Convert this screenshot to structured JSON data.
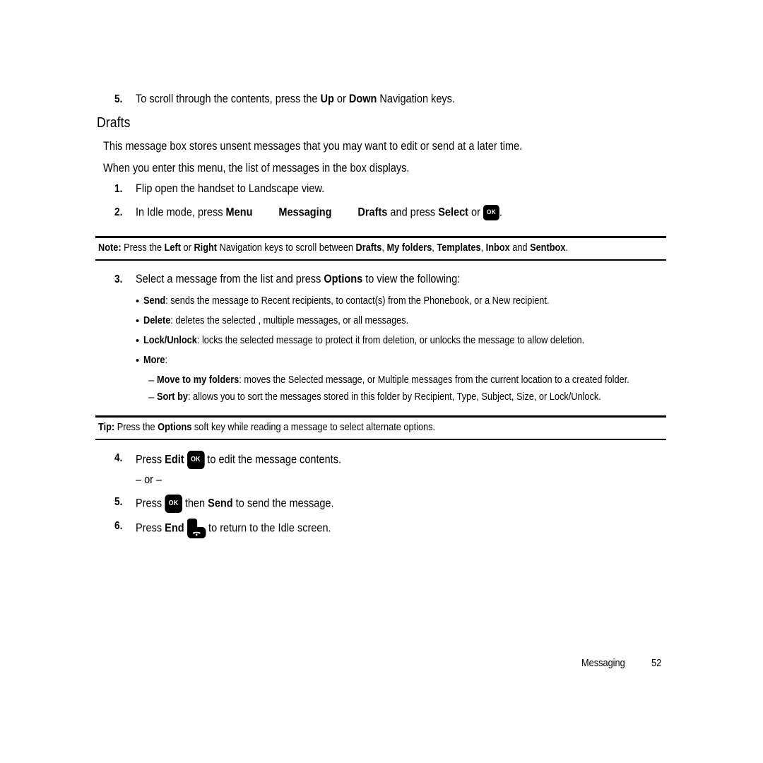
{
  "document": {
    "page_number": "52",
    "footer_section": "Messaging",
    "heading": "Drafts"
  },
  "intro_step": {
    "number": "5.",
    "text_before": "To scroll through the contents, press the ",
    "bold_1": "Up",
    "text_mid": " or ",
    "bold_2": "Down",
    "text_after": " Navigation keys."
  },
  "paragraphs": [
    "This message box stores unsent messages that you may want to edit or send at a later time.",
    "When you enter this menu, the list of messages in the box displays."
  ],
  "steps": {
    "one": {
      "number": "1.",
      "text": "Flip open the handset to Landscape view."
    },
    "two": {
      "number": "2.",
      "text_before": "In Idle mode, press ",
      "menu": "Menu",
      "messaging": "Messaging",
      "drafts": "Drafts",
      "text_mid": " and press ",
      "select": "Select",
      "text_or": " or ",
      "ok_key_label": "OK",
      "text_end": "."
    },
    "three": {
      "number": "3.",
      "text_before": "Select a message from the list and press ",
      "bold": "Options",
      "text_after": " to view the following:"
    },
    "four": {
      "number": "4.",
      "text_before": "Press ",
      "bold": "Edit",
      "ok_key_label": "OK",
      "text_after": " to edit the message contents."
    },
    "or_separator": "– or –",
    "five": {
      "number": "5.",
      "text_before": "Press ",
      "ok_key_label": "OK",
      "text_mid": " then ",
      "bold": "Send",
      "text_after": " to send the message."
    },
    "six": {
      "number": "6.",
      "text_before": "Press ",
      "bold": "End",
      "text_after": " to return to the Idle screen."
    }
  },
  "options_bullets": [
    {
      "marker": "•",
      "term": "Send",
      "description": ": sends the message to Recent recipients, to contact(s) from the Phonebook, or a New recipient."
    },
    {
      "marker": "•",
      "term": "Delete",
      "description": ": deletes the selected , multiple messages, or all messages."
    },
    {
      "marker": "•",
      "term": "Lock/Unlock",
      "description": ": locks the selected message to protect it from deletion, or unlocks the message to allow deletion."
    },
    {
      "marker": "•",
      "term": "More",
      "description": ":"
    }
  ],
  "sub_bullets": [
    {
      "marker": "–",
      "term": "Move to my folders",
      "description": ": moves the Selected message, or Multiple messages from the current location to a created folder."
    },
    {
      "marker": "–",
      "term": "Sort by",
      "description": ": allows you to sort the messages stored in this folder by Recipient, Type, Subject, Size, or Lock/Unlock."
    }
  ],
  "note_block": {
    "label": "Note:",
    "t1": " Press the ",
    "b1": "Left",
    "t2": " or ",
    "b2": "Right",
    "t3": " Navigation keys to scroll between ",
    "b3": "Drafts",
    "t4": ", ",
    "b4": "My folders",
    "t5": ", ",
    "b5": "Templates",
    "t6": ", ",
    "b6": "Inbox",
    "t7": " and ",
    "b7": "Sentbox",
    "t8": "."
  },
  "tip_block": {
    "label": "Tip:",
    "t1": " Press the ",
    "b1": "Options",
    "t2": " soft key while reading a message to select alternate options."
  }
}
